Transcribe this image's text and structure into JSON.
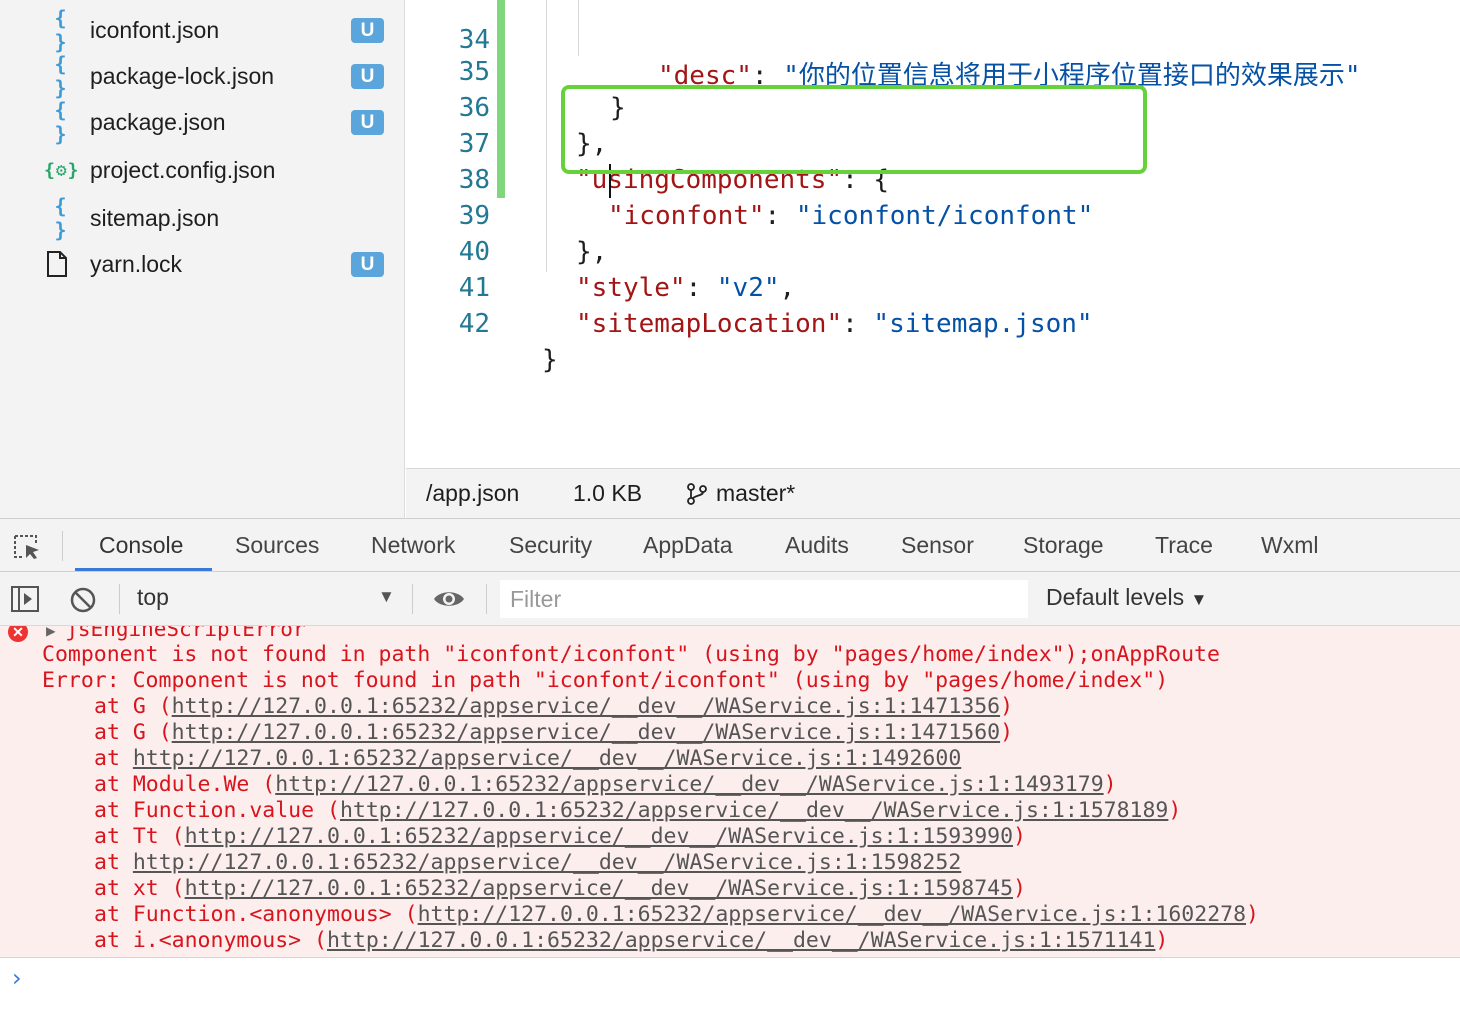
{
  "explorer": {
    "files": [
      {
        "icon": "{ }",
        "name": "iconfont.json",
        "badge": "U"
      },
      {
        "icon": "{ }",
        "name": "package-lock.json",
        "badge": "U"
      },
      {
        "icon": "{ }",
        "name": "package.json",
        "badge": "U"
      },
      {
        "icon": "{⚙}",
        "name": "project.config.json",
        "badge": ""
      },
      {
        "icon": "{ }",
        "name": "sitemap.json",
        "badge": ""
      },
      {
        "icon": "file-icon",
        "name": "yarn.lock",
        "badge": "U"
      }
    ]
  },
  "editor": {
    "lines": [
      {
        "no": "34",
        "parts": [
          [
            "key",
            "\"desc\""
          ],
          [
            "plain",
            ": "
          ],
          [
            "str",
            "\"你的位置信息将用于小程序位置接口的效果展示\""
          ]
        ]
      },
      {
        "no": "35",
        "parts": [
          [
            "plain",
            "}"
          ]
        ]
      },
      {
        "no": "36",
        "parts": [
          [
            "plain",
            "},"
          ]
        ]
      },
      {
        "no": "37",
        "parts": [
          [
            "key",
            "\"usingComponents\""
          ],
          [
            "plain",
            ": {"
          ]
        ]
      },
      {
        "no": "38",
        "parts": [
          [
            "key",
            "\"iconfont\""
          ],
          [
            "plain",
            ": "
          ],
          [
            "str",
            "\"iconfont/iconfont\""
          ]
        ]
      },
      {
        "no": "39",
        "parts": [
          [
            "plain",
            "},"
          ]
        ]
      },
      {
        "no": "40",
        "parts": [
          [
            "key",
            "\"style\""
          ],
          [
            "plain",
            ": "
          ],
          [
            "str",
            "\"v2\""
          ],
          [
            "plain",
            ","
          ]
        ]
      },
      {
        "no": "41",
        "parts": [
          [
            "key",
            "\"sitemapLocation\""
          ],
          [
            "plain",
            ": "
          ],
          [
            "str",
            "\"sitemap.json\""
          ]
        ]
      },
      {
        "no": "42",
        "parts": [
          [
            "plain",
            "}"
          ]
        ]
      }
    ]
  },
  "statusbar": {
    "path": "/app.json",
    "size": "1.0 KB",
    "branch": "master*"
  },
  "devtools": {
    "tabs": [
      "Console",
      "Sources",
      "Network",
      "Security",
      "AppData",
      "Audits",
      "Sensor",
      "Storage",
      "Trace",
      "Wxml"
    ],
    "active_tab": "Console"
  },
  "console_toolbar": {
    "context": "top",
    "filter_placeholder": "Filter",
    "levels": "Default levels"
  },
  "console": {
    "error_title": "jsEngineScriptError",
    "lines": [
      {
        "kind": "msg",
        "text": "Component is not found in path \"iconfont/iconfont\" (using by \"pages/home/index\");onAppRoute"
      },
      {
        "kind": "msg",
        "text": "Error: Component is not found in path \"iconfont/iconfont\" (using by \"pages/home/index\")"
      },
      {
        "kind": "frame",
        "prefix": "at G (",
        "link": "http://127.0.0.1:65232/appservice/__dev__/WAService.js:1:1471356",
        "suffix": ")"
      },
      {
        "kind": "frame",
        "prefix": "at G (",
        "link": "http://127.0.0.1:65232/appservice/__dev__/WAService.js:1:1471560",
        "suffix": ")"
      },
      {
        "kind": "frame",
        "prefix": "at ",
        "link": "http://127.0.0.1:65232/appservice/__dev__/WAService.js:1:1492600",
        "suffix": ""
      },
      {
        "kind": "frame",
        "prefix": "at Module.We (",
        "link": "http://127.0.0.1:65232/appservice/__dev__/WAService.js:1:1493179",
        "suffix": ")"
      },
      {
        "kind": "frame",
        "prefix": "at Function.value (",
        "link": "http://127.0.0.1:65232/appservice/__dev__/WAService.js:1:1578189",
        "suffix": ")"
      },
      {
        "kind": "frame",
        "prefix": "at Tt (",
        "link": "http://127.0.0.1:65232/appservice/__dev__/WAService.js:1:1593990",
        "suffix": ")"
      },
      {
        "kind": "frame",
        "prefix": "at ",
        "link": "http://127.0.0.1:65232/appservice/__dev__/WAService.js:1:1598252",
        "suffix": ""
      },
      {
        "kind": "frame",
        "prefix": "at xt (",
        "link": "http://127.0.0.1:65232/appservice/__dev__/WAService.js:1:1598745",
        "suffix": ")"
      },
      {
        "kind": "frame",
        "prefix": "at Function.<anonymous> (",
        "link": "http://127.0.0.1:65232/appservice/__dev__/WAService.js:1:1602278",
        "suffix": ")"
      },
      {
        "kind": "frame",
        "prefix": "at i.<anonymous> (",
        "link": "http://127.0.0.1:65232/appservice/__dev__/WAService.js:1:1571141",
        "suffix": ")"
      }
    ]
  },
  "colors": {
    "accent": "#3879d9",
    "highlight": "#66d23a",
    "error": "#d8141d",
    "error_bg": "#fdeeee",
    "badge": "#5aa6dc"
  }
}
